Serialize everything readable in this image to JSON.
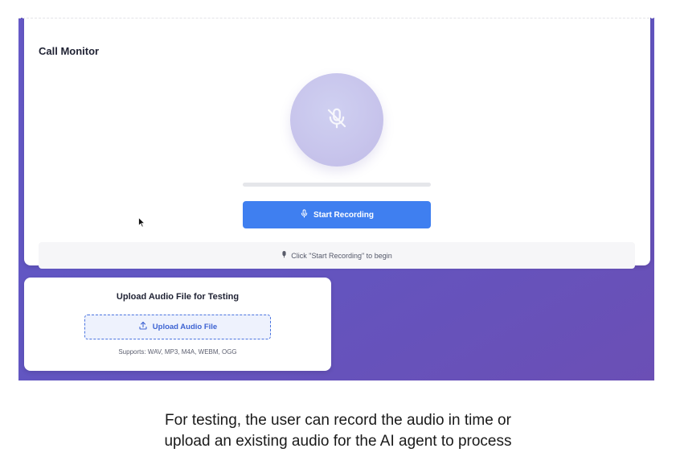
{
  "monitor": {
    "title": "Call Monitor",
    "mic_icon": "mic-off-icon",
    "record_button_label": "Start Recording",
    "record_button_icon": "microphone-icon",
    "level_fraction": 0,
    "status_icon": "microphone-icon",
    "status_text": "Click \"Start Recording\" to begin"
  },
  "upload": {
    "title": "Upload Audio File for Testing",
    "button_label": "Upload Audio File",
    "button_icon": "upload-icon",
    "supports_text": "Supports: WAV, MP3, M4A, WEBM, OGG"
  },
  "caption": {
    "line1": "For testing, the user can record the audio in time or",
    "line2": "upload an existing audio for the AI agent to process"
  },
  "colors": {
    "accent": "#3f7ff0",
    "background_gradient_start": "#6659c7",
    "background_gradient_end": "#6b4fb5",
    "mic_circle": "#c8c5ec"
  }
}
